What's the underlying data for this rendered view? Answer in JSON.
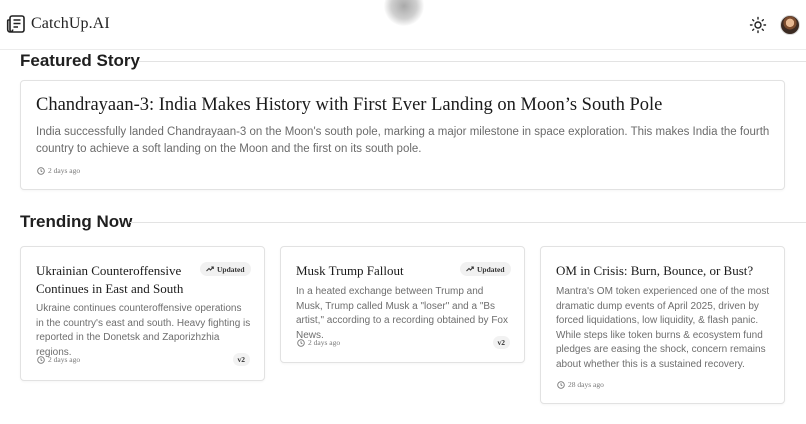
{
  "header": {
    "brand": "CatchUp.AI",
    "logo_icon": "newspaper-icon",
    "theme_icon": "sun-icon",
    "avatar": "user-avatar"
  },
  "featured": {
    "section_title": "Featured Story",
    "title": "Chandrayaan-3: India Makes History with First Ever Landing on Moon’s South Pole",
    "description": "India successfully landed Chandrayaan-3 on the Moon's south pole, marking a major milestone in space exploration. This makes India the fourth country to achieve a soft landing on the Moon and the first on its south pole.",
    "time": "2 days ago"
  },
  "trending": {
    "section_title": "Trending Now",
    "cards": [
      {
        "title": "Ukrainian Counteroffensive Continues in East and South",
        "badge": "Updated",
        "description": "Ukraine continues counteroffensive operations in the country's east and south. Heavy fighting is reported in the Donetsk and Zaporizhzhia regions.",
        "time": "2 days ago",
        "version": "v2"
      },
      {
        "title": "Musk Trump Fallout",
        "badge": "Updated",
        "description": "In a heated exchange between Trump and Musk, Trump called Musk a \"loser\" and a \"Bs artist,\" according to a recording obtained by Fox News.",
        "time": "2 days ago",
        "version": "v2"
      },
      {
        "title": "OM in Crisis: Burn, Bounce, or Bust?",
        "description": "Mantra's OM token experienced one of the most dramatic dump events of April 2025, driven by forced liquidations, low liquidity, & flash panic. While steps like token burns & ecosystem fund pledges are easing the shock, concern remains about whether this is a sustained recovery.",
        "time": "28 days ago"
      }
    ]
  }
}
